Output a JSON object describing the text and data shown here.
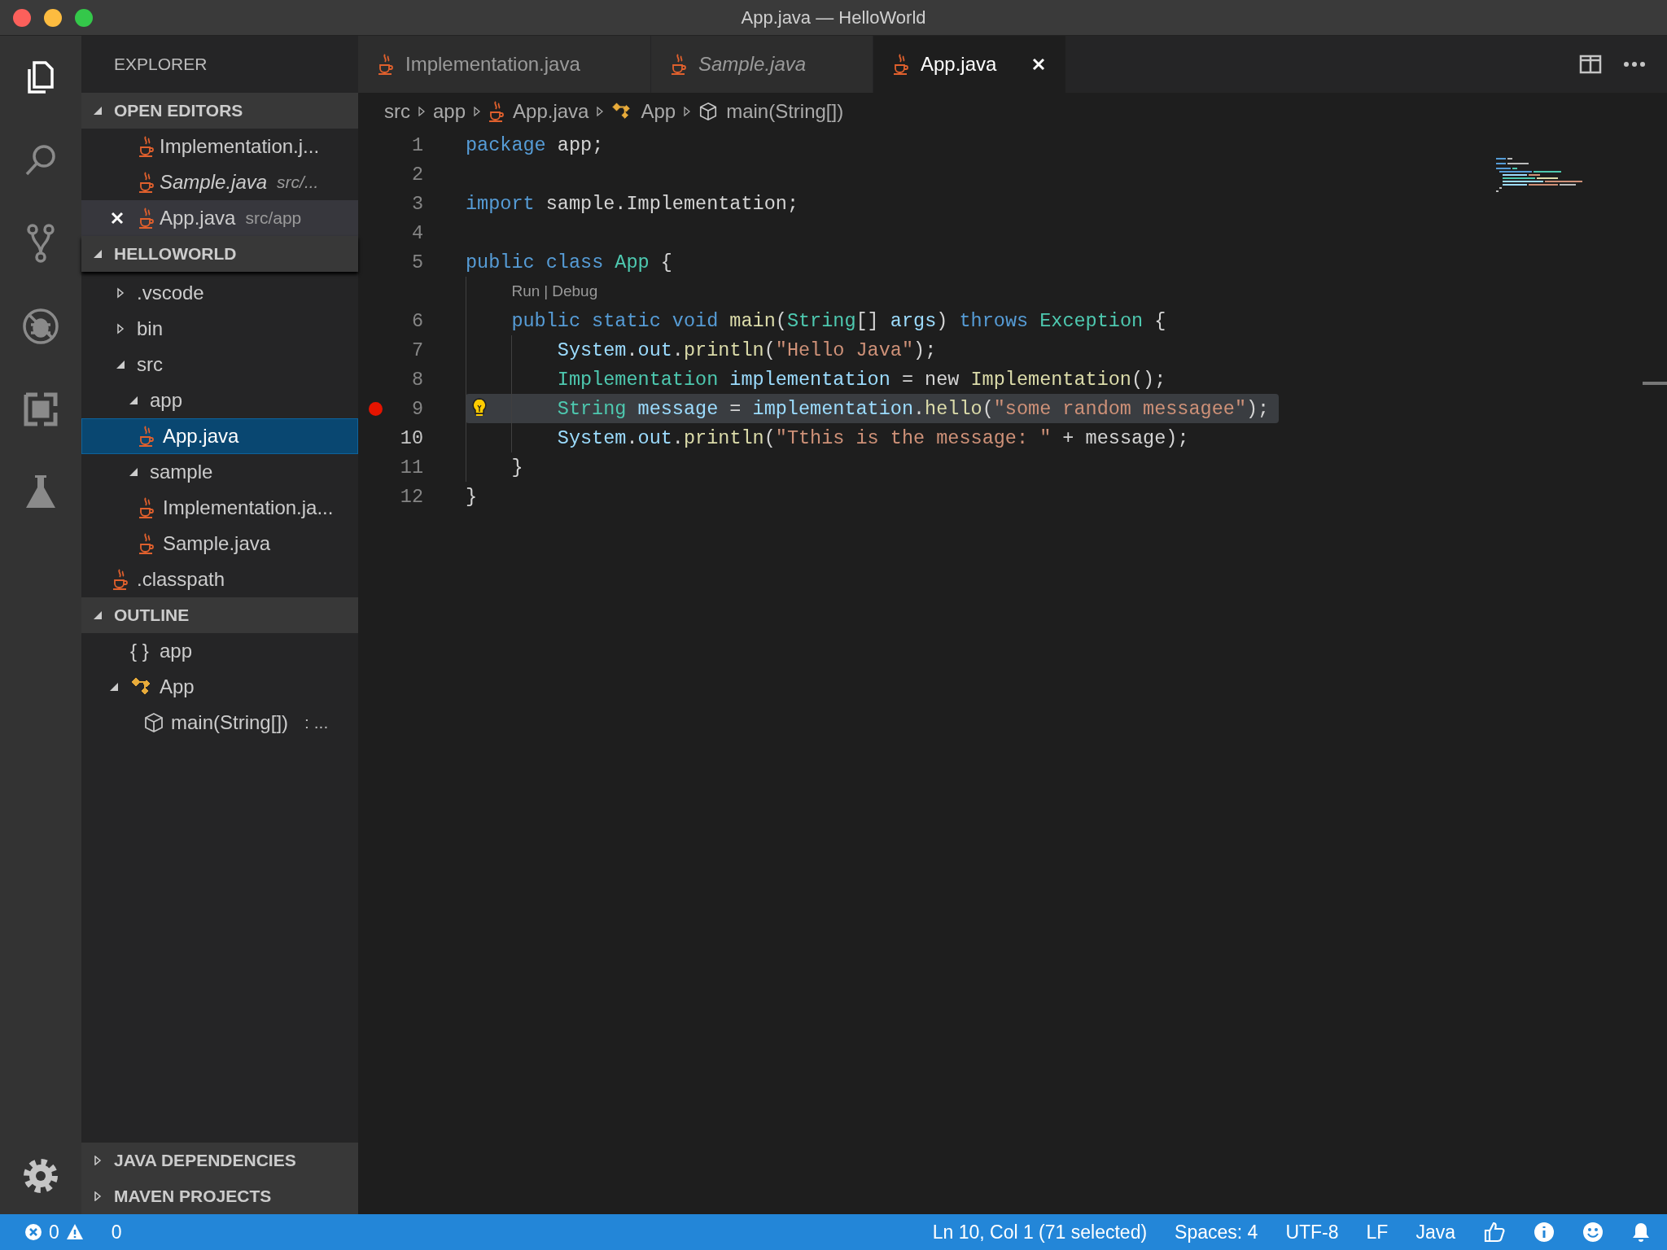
{
  "window": {
    "title": "App.java — HelloWorld"
  },
  "activity_bar": [
    {
      "kind": "files",
      "selected": true
    },
    {
      "kind": "search",
      "selected": false
    },
    {
      "kind": "git",
      "selected": false
    },
    {
      "kind": "debug",
      "selected": false
    },
    {
      "kind": "extensions",
      "selected": false
    },
    {
      "kind": "test",
      "selected": false
    }
  ],
  "explorer": {
    "title": "EXPLORER",
    "open_editors": {
      "title": "OPEN EDITORS",
      "expanded": true,
      "items": [
        {
          "name": "Implementation.j...",
          "italic": false,
          "selected": false,
          "show_close": false
        },
        {
          "name": "Sample.java",
          "path": "src/...",
          "italic": true,
          "selected": false,
          "show_close": false
        },
        {
          "name": "App.java",
          "path": "src/app",
          "italic": false,
          "selected": true,
          "show_close": true
        }
      ]
    },
    "project": {
      "title": "HELLOWORLD",
      "expanded": true
    },
    "tree": [
      {
        "name": ".vscode",
        "kind": "folder",
        "expanded": false,
        "selected": false
      },
      {
        "name": "bin",
        "kind": "folder",
        "expanded": false,
        "selected": false
      },
      {
        "name": "src",
        "kind": "folder",
        "expanded": true,
        "selected": false,
        "children": [
          {
            "name": "app",
            "kind": "folder",
            "expanded": true,
            "selected": false,
            "children": [
              {
                "name": "App.java",
                "kind": "file",
                "selected": true
              }
            ]
          },
          {
            "name": "sample",
            "kind": "folder",
            "expanded": true,
            "selected": false,
            "children": [
              {
                "name": "Implementation.ja...",
                "kind": "file",
                "selected": false
              },
              {
                "name": "Sample.java",
                "kind": "file",
                "selected": false
              }
            ]
          }
        ]
      },
      {
        "name": ".classpath",
        "kind": "file",
        "selected": false
      }
    ]
  },
  "outline": {
    "title": "OUTLINE",
    "expanded": true,
    "items": [
      {
        "name": "app",
        "kind": "namespace",
        "glyph": "{ }"
      },
      {
        "name": "App",
        "kind": "class",
        "expanded": true,
        "children": [
          {
            "name": "main(String[])",
            "kind": "method",
            "detail": ": ..."
          }
        ]
      }
    ]
  },
  "bottom_sections": [
    {
      "title": "JAVA DEPENDENCIES",
      "expanded": false
    },
    {
      "title": "MAVEN PROJECTS",
      "expanded": false
    }
  ],
  "tabs": [
    {
      "label": "Implementation.java",
      "italic": false,
      "selected": false,
      "show_close": false
    },
    {
      "label": "Sample.java",
      "italic": true,
      "selected": false,
      "show_close": false
    },
    {
      "label": "App.java",
      "italic": false,
      "selected": true,
      "show_close": true
    }
  ],
  "breadcrumbs": [
    {
      "text": "src",
      "kind": "folder"
    },
    {
      "text": "app",
      "kind": "folder"
    },
    {
      "text": "App.java",
      "kind": "java"
    },
    {
      "text": "App",
      "kind": "class"
    },
    {
      "text": "main(String[])",
      "kind": "method"
    }
  ],
  "code": [
    {
      "kind": "code",
      "number": "1",
      "breakpoint": false,
      "current": false,
      "selected": false,
      "lightbulb": false,
      "tokens": [
        {
          "kind": "keyword",
          "t": "package"
        },
        {
          "kind": "plain",
          "t": " app;"
        }
      ]
    },
    {
      "kind": "code",
      "number": "2",
      "breakpoint": false,
      "current": false,
      "selected": false,
      "lightbulb": false
    },
    {
      "kind": "code",
      "number": "3",
      "breakpoint": false,
      "current": false,
      "selected": false,
      "lightbulb": false,
      "tokens": [
        {
          "kind": "keyword",
          "t": "import"
        },
        {
          "kind": "plain",
          "t": " sample.Implementation;"
        }
      ]
    },
    {
      "kind": "code",
      "number": "4",
      "breakpoint": false,
      "current": false,
      "selected": false,
      "lightbulb": false
    },
    {
      "kind": "code",
      "number": "5",
      "breakpoint": false,
      "current": false,
      "selected": false,
      "lightbulb": false,
      "tokens": [
        {
          "kind": "keyword",
          "t": "public class "
        },
        {
          "kind": "type",
          "t": "App"
        },
        {
          "kind": "plain",
          "t": " {"
        }
      ],
      "children": [
        {
          "kind": "codelens",
          "links": [
            "Run",
            "Debug"
          ],
          "separator": "|"
        },
        {
          "kind": "code",
          "number": "6",
          "breakpoint": false,
          "current": false,
          "selected": false,
          "lightbulb": false,
          "tokens": [
            {
              "kind": "keyword",
              "t": "public static void "
            },
            {
              "kind": "function",
              "t": "main"
            },
            {
              "kind": "plain",
              "t": "("
            },
            {
              "kind": "type",
              "t": "String"
            },
            {
              "kind": "plain",
              "t": "[] "
            },
            {
              "kind": "variable",
              "t": "args"
            },
            {
              "kind": "plain",
              "t": ") "
            },
            {
              "kind": "keyword",
              "t": "throws "
            },
            {
              "kind": "type",
              "t": "Exception"
            },
            {
              "kind": "plain",
              "t": " {"
            }
          ],
          "children": [
            {
              "kind": "code",
              "number": "7",
              "breakpoint": false,
              "current": false,
              "selected": false,
              "lightbulb": false,
              "tokens": [
                {
                  "kind": "variable",
                  "t": "System"
                },
                {
                  "kind": "plain",
                  "t": "."
                },
                {
                  "kind": "variable",
                  "t": "out"
                },
                {
                  "kind": "plain",
                  "t": "."
                },
                {
                  "kind": "function",
                  "t": "println"
                },
                {
                  "kind": "plain",
                  "t": "("
                },
                {
                  "kind": "string",
                  "t": "\"Hello Java\""
                },
                {
                  "kind": "plain",
                  "t": ");"
                }
              ]
            },
            {
              "kind": "code",
              "number": "8",
              "breakpoint": false,
              "current": false,
              "selected": false,
              "lightbulb": false,
              "tokens": [
                {
                  "kind": "type",
                  "t": "Implementation "
                },
                {
                  "kind": "variable",
                  "t": "implementation"
                },
                {
                  "kind": "plain",
                  "t": " = new "
                },
                {
                  "kind": "function",
                  "t": "Implementation"
                },
                {
                  "kind": "plain",
                  "t": "();"
                }
              ]
            },
            {
              "kind": "code",
              "number": "9",
              "breakpoint": true,
              "current": false,
              "selected": true,
              "lightbulb": true,
              "tokens": [
                {
                  "kind": "type",
                  "t": "String "
                },
                {
                  "kind": "variable",
                  "t": "message"
                },
                {
                  "kind": "plain",
                  "t": " = "
                },
                {
                  "kind": "variable",
                  "t": "implementation"
                },
                {
                  "kind": "plain",
                  "t": "."
                },
                {
                  "kind": "function",
                  "t": "hello"
                },
                {
                  "kind": "plain",
                  "t": "("
                },
                {
                  "kind": "string",
                  "t": "\"some random messagee\""
                },
                {
                  "kind": "plain",
                  "t": ");"
                }
              ]
            },
            {
              "kind": "code",
              "number": "10",
              "breakpoint": false,
              "current": true,
              "selected": false,
              "lightbulb": false,
              "tokens": [
                {
                  "kind": "variable",
                  "t": "System"
                },
                {
                  "kind": "plain",
                  "t": "."
                },
                {
                  "kind": "variable",
                  "t": "out"
                },
                {
                  "kind": "plain",
                  "t": "."
                },
                {
                  "kind": "function",
                  "t": "println"
                },
                {
                  "kind": "plain",
                  "t": "("
                },
                {
                  "kind": "string",
                  "t": "\"Tthis is the message: \""
                },
                {
                  "kind": "plain",
                  "t": " + message);"
                }
              ]
            }
          ]
        },
        {
          "kind": "code",
          "number": "11",
          "breakpoint": false,
          "current": false,
          "selected": false,
          "lightbulb": false,
          "tokens": [
            {
              "kind": "plain",
              "t": "}"
            }
          ]
        }
      ]
    },
    {
      "kind": "code",
      "number": "12",
      "breakpoint": false,
      "current": false,
      "selected": false,
      "lightbulb": false,
      "tokens": [
        {
          "kind": "plain",
          "t": "}"
        }
      ]
    }
  ],
  "status_bar": {
    "errors": "0",
    "warnings": "0",
    "items": [
      "Ln 10, Col 1 (71 selected)",
      "Spaces: 4",
      "UTF-8",
      "LF",
      "Java"
    ]
  }
}
